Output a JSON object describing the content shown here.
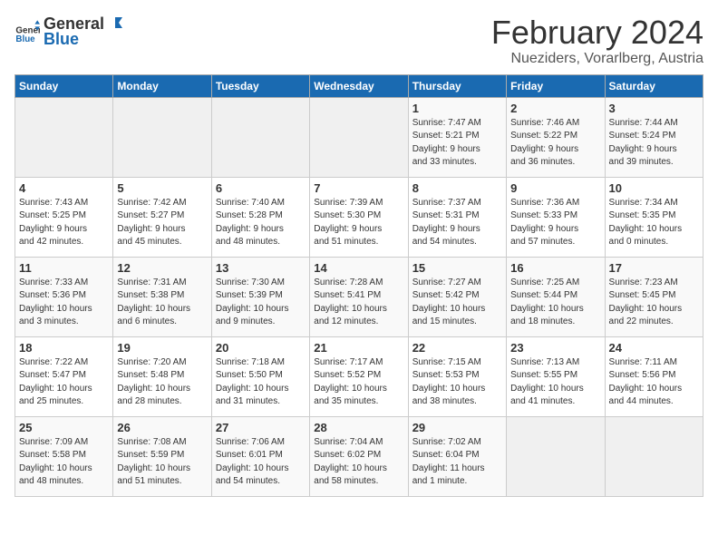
{
  "header": {
    "logo_general": "General",
    "logo_blue": "Blue",
    "month": "February 2024",
    "location": "Nueziders, Vorarlberg, Austria"
  },
  "days_of_week": [
    "Sunday",
    "Monday",
    "Tuesday",
    "Wednesday",
    "Thursday",
    "Friday",
    "Saturday"
  ],
  "weeks": [
    [
      {
        "day": "",
        "info": ""
      },
      {
        "day": "",
        "info": ""
      },
      {
        "day": "",
        "info": ""
      },
      {
        "day": "",
        "info": ""
      },
      {
        "day": "1",
        "info": "Sunrise: 7:47 AM\nSunset: 5:21 PM\nDaylight: 9 hours\nand 33 minutes."
      },
      {
        "day": "2",
        "info": "Sunrise: 7:46 AM\nSunset: 5:22 PM\nDaylight: 9 hours\nand 36 minutes."
      },
      {
        "day": "3",
        "info": "Sunrise: 7:44 AM\nSunset: 5:24 PM\nDaylight: 9 hours\nand 39 minutes."
      }
    ],
    [
      {
        "day": "4",
        "info": "Sunrise: 7:43 AM\nSunset: 5:25 PM\nDaylight: 9 hours\nand 42 minutes."
      },
      {
        "day": "5",
        "info": "Sunrise: 7:42 AM\nSunset: 5:27 PM\nDaylight: 9 hours\nand 45 minutes."
      },
      {
        "day": "6",
        "info": "Sunrise: 7:40 AM\nSunset: 5:28 PM\nDaylight: 9 hours\nand 48 minutes."
      },
      {
        "day": "7",
        "info": "Sunrise: 7:39 AM\nSunset: 5:30 PM\nDaylight: 9 hours\nand 51 minutes."
      },
      {
        "day": "8",
        "info": "Sunrise: 7:37 AM\nSunset: 5:31 PM\nDaylight: 9 hours\nand 54 minutes."
      },
      {
        "day": "9",
        "info": "Sunrise: 7:36 AM\nSunset: 5:33 PM\nDaylight: 9 hours\nand 57 minutes."
      },
      {
        "day": "10",
        "info": "Sunrise: 7:34 AM\nSunset: 5:35 PM\nDaylight: 10 hours\nand 0 minutes."
      }
    ],
    [
      {
        "day": "11",
        "info": "Sunrise: 7:33 AM\nSunset: 5:36 PM\nDaylight: 10 hours\nand 3 minutes."
      },
      {
        "day": "12",
        "info": "Sunrise: 7:31 AM\nSunset: 5:38 PM\nDaylight: 10 hours\nand 6 minutes."
      },
      {
        "day": "13",
        "info": "Sunrise: 7:30 AM\nSunset: 5:39 PM\nDaylight: 10 hours\nand 9 minutes."
      },
      {
        "day": "14",
        "info": "Sunrise: 7:28 AM\nSunset: 5:41 PM\nDaylight: 10 hours\nand 12 minutes."
      },
      {
        "day": "15",
        "info": "Sunrise: 7:27 AM\nSunset: 5:42 PM\nDaylight: 10 hours\nand 15 minutes."
      },
      {
        "day": "16",
        "info": "Sunrise: 7:25 AM\nSunset: 5:44 PM\nDaylight: 10 hours\nand 18 minutes."
      },
      {
        "day": "17",
        "info": "Sunrise: 7:23 AM\nSunset: 5:45 PM\nDaylight: 10 hours\nand 22 minutes."
      }
    ],
    [
      {
        "day": "18",
        "info": "Sunrise: 7:22 AM\nSunset: 5:47 PM\nDaylight: 10 hours\nand 25 minutes."
      },
      {
        "day": "19",
        "info": "Sunrise: 7:20 AM\nSunset: 5:48 PM\nDaylight: 10 hours\nand 28 minutes."
      },
      {
        "day": "20",
        "info": "Sunrise: 7:18 AM\nSunset: 5:50 PM\nDaylight: 10 hours\nand 31 minutes."
      },
      {
        "day": "21",
        "info": "Sunrise: 7:17 AM\nSunset: 5:52 PM\nDaylight: 10 hours\nand 35 minutes."
      },
      {
        "day": "22",
        "info": "Sunrise: 7:15 AM\nSunset: 5:53 PM\nDaylight: 10 hours\nand 38 minutes."
      },
      {
        "day": "23",
        "info": "Sunrise: 7:13 AM\nSunset: 5:55 PM\nDaylight: 10 hours\nand 41 minutes."
      },
      {
        "day": "24",
        "info": "Sunrise: 7:11 AM\nSunset: 5:56 PM\nDaylight: 10 hours\nand 44 minutes."
      }
    ],
    [
      {
        "day": "25",
        "info": "Sunrise: 7:09 AM\nSunset: 5:58 PM\nDaylight: 10 hours\nand 48 minutes."
      },
      {
        "day": "26",
        "info": "Sunrise: 7:08 AM\nSunset: 5:59 PM\nDaylight: 10 hours\nand 51 minutes."
      },
      {
        "day": "27",
        "info": "Sunrise: 7:06 AM\nSunset: 6:01 PM\nDaylight: 10 hours\nand 54 minutes."
      },
      {
        "day": "28",
        "info": "Sunrise: 7:04 AM\nSunset: 6:02 PM\nDaylight: 10 hours\nand 58 minutes."
      },
      {
        "day": "29",
        "info": "Sunrise: 7:02 AM\nSunset: 6:04 PM\nDaylight: 11 hours\nand 1 minute."
      },
      {
        "day": "",
        "info": ""
      },
      {
        "day": "",
        "info": ""
      }
    ]
  ]
}
